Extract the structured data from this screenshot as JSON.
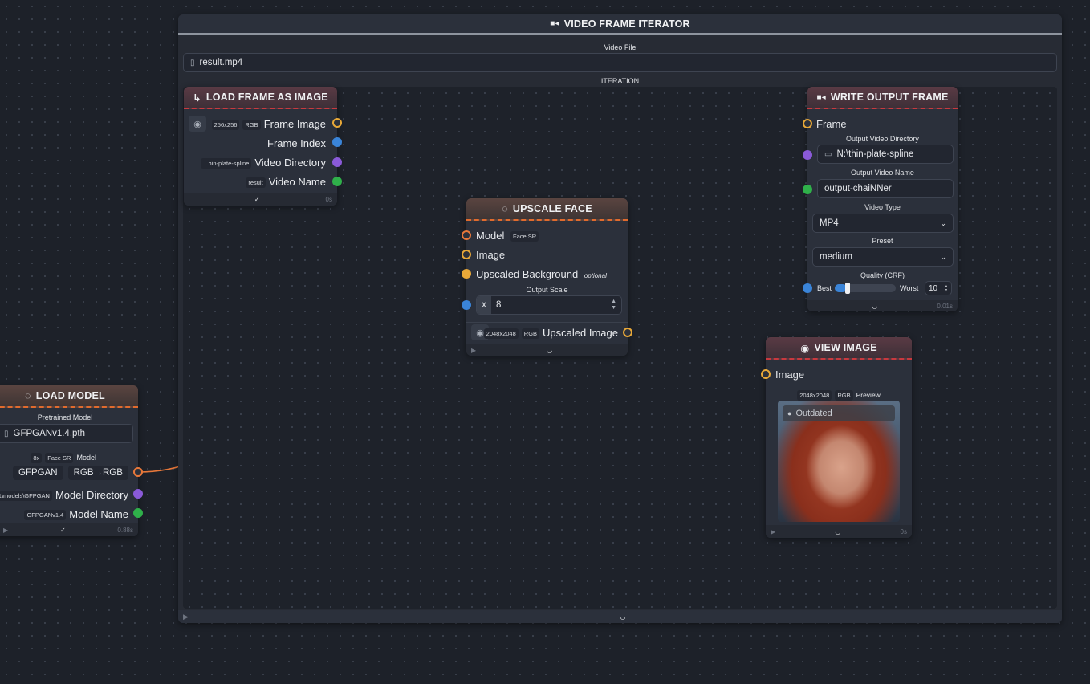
{
  "colors": {
    "image_category": "#c9393e",
    "pytorch_category": "#e16b2d",
    "image_port": "#e8a838",
    "model_port": "#e8783a",
    "number_port": "#3a84d8",
    "directory_port": "#8a5ad8",
    "text_port": "#2fb04a"
  },
  "iterator": {
    "title": "VIDEO FRAME ITERATOR",
    "icon": "video-icon",
    "video_file_label": "Video File",
    "video_file_value": "result.mp4",
    "iteration_label": "ITERATION"
  },
  "load_frame": {
    "title": "LOAD FRAME AS IMAGE",
    "icon": "arrow-return-icon",
    "frame_image_size": "256x256",
    "frame_image_mode": "RGB",
    "frame_image_label": "Frame Image",
    "frame_index_label": "Frame Index",
    "video_directory_value": "...hin-plate-spline",
    "video_directory_label": "Video Directory",
    "video_name_value": "result",
    "video_name_label": "Video Name",
    "timing": "0s"
  },
  "upscale_face": {
    "title": "UPSCALE FACE",
    "icon": "loading-icon",
    "model_label": "Model",
    "model_tag": "Face SR",
    "image_label": "Image",
    "bg_label": "Upscaled Background",
    "bg_tag": "optional",
    "scale_label": "Output Scale",
    "scale_prefix": "x",
    "scale_value": "8",
    "output_size": "2048x2048",
    "output_mode": "RGB",
    "output_label": "Upscaled Image"
  },
  "write_output": {
    "title": "WRITE OUTPUT FRAME",
    "icon": "video-icon",
    "frame_label": "Frame",
    "dir_label": "Output Video Directory",
    "dir_value": "N:\\thin-plate-spline",
    "name_label": "Output Video Name",
    "name_value": "output-chaiNNer",
    "type_label": "Video Type",
    "type_value": "MP4",
    "preset_label": "Preset",
    "preset_value": "medium",
    "quality_label": "Quality (CRF)",
    "quality_min_label": "Best",
    "quality_max_label": "Worst",
    "quality_value": "10",
    "quality_fraction": 0.2,
    "timing": "0.01s"
  },
  "view_image": {
    "title": "VIEW IMAGE",
    "icon": "eye-icon",
    "image_label": "Image",
    "size": "2048x2048",
    "mode": "RGB",
    "preview_label": "Preview",
    "outdated_label": "Outdated",
    "timing": "0s"
  },
  "load_model": {
    "title": "LOAD MODEL",
    "icon": "loading-icon",
    "pretrained_label": "Pretrained Model",
    "pretrained_value": "GFPGANv1.4.pth",
    "scale_tag": "8x",
    "type_tag": "Face SR",
    "model_label": "Model",
    "arch_chip": "GFPGAN",
    "color_chip": "RGB→RGB",
    "dir_value": "...1\\models\\GFPGAN",
    "dir_label": "Model Directory",
    "name_value": "GFPGANv1.4",
    "name_label": "Model Name",
    "timing": "0.88s"
  }
}
